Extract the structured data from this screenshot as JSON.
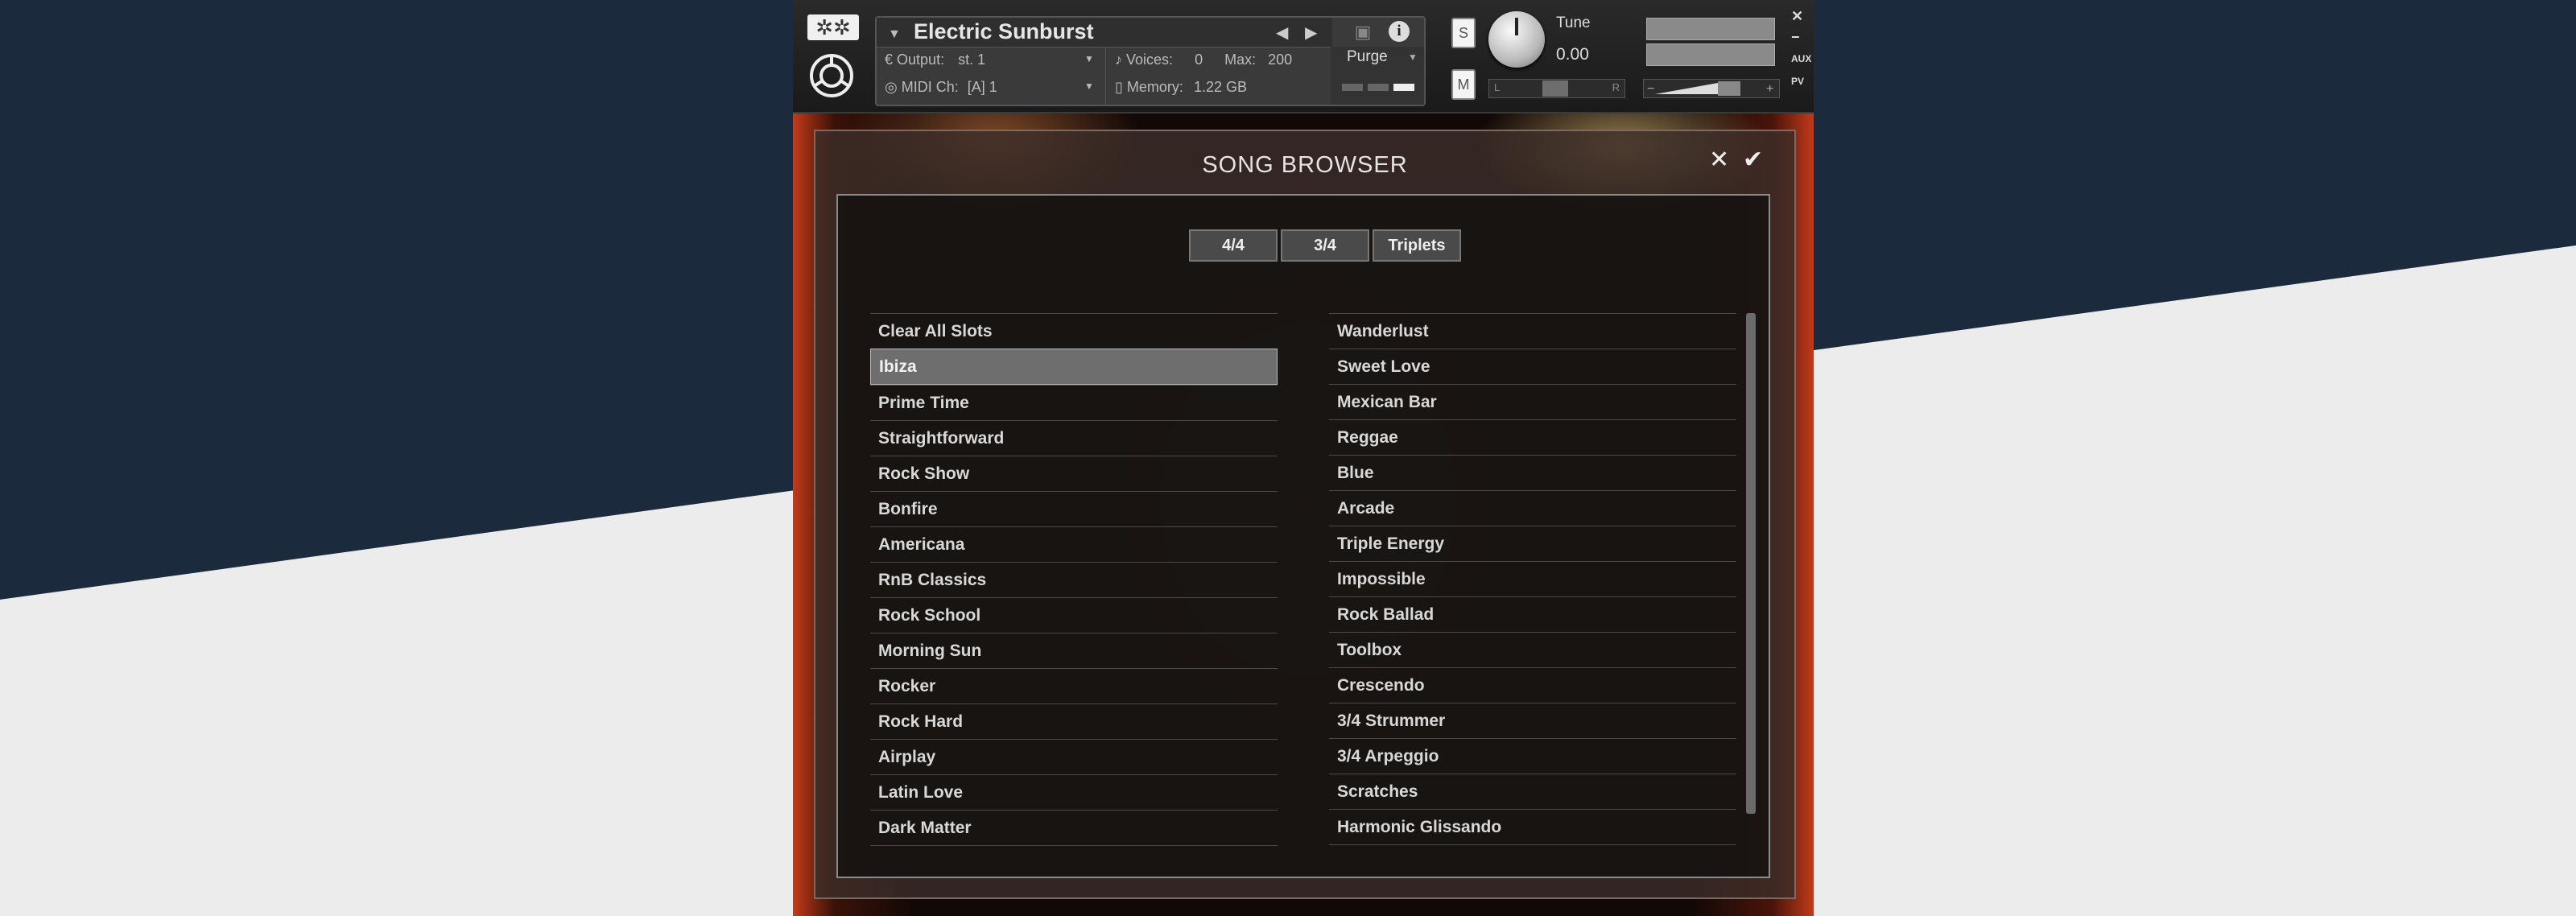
{
  "colors": {
    "background_navy": "#1c2a3e",
    "background_light": "#ececec",
    "panel_dark": "#0d0d0d",
    "accent_red": "#c43a1a"
  },
  "header": {
    "instrument_name": "Electric Sunburst",
    "output_label": "Output:",
    "output_value": "st. 1",
    "voices_label": "Voices:",
    "voices_value": "0",
    "max_label": "Max:",
    "max_value": "200",
    "midi_label": "MIDI Ch:",
    "midi_value": "[A]  1",
    "memory_label": "Memory:",
    "memory_value": "1.22 GB",
    "purge_label": "Purge",
    "solo_label": "S",
    "mute_label": "M",
    "tune_label": "Tune",
    "tune_value": "0.00",
    "pan_left": "L",
    "pan_right": "R",
    "aux_label": "AUX",
    "pv_label": "PV"
  },
  "dialog": {
    "title": "SONG BROWSER",
    "close_glyph": "✕",
    "confirm_glyph": "✔",
    "tabs": [
      "4/4",
      "3/4",
      "Triplets"
    ],
    "left_songs": [
      "Clear All Slots",
      "Ibiza",
      "Prime Time",
      "Straightforward",
      "Rock Show",
      "Bonfire",
      "Americana",
      "RnB Classics",
      "Rock School",
      "Morning Sun",
      "Rocker",
      "Rock Hard",
      "Airplay",
      "Latin Love",
      "Dark Matter"
    ],
    "right_songs": [
      "Wanderlust",
      "Sweet Love",
      "Mexican Bar",
      "Reggae",
      "Blue",
      "Arcade",
      "Triple Energy",
      "Impossible",
      "Rock Ballad",
      "Toolbox",
      "Crescendo",
      "3/4 Strummer",
      "3/4 Arpeggio",
      "Scratches",
      "Harmonic Glissando"
    ],
    "selected_song": "Ibiza"
  },
  "icons": [
    "gear-icon",
    "logo-icon",
    "dropdown-icon",
    "prev-arrow-icon",
    "next-arrow-icon",
    "camera-icon",
    "info-icon",
    "close-icon",
    "check-icon"
  ]
}
